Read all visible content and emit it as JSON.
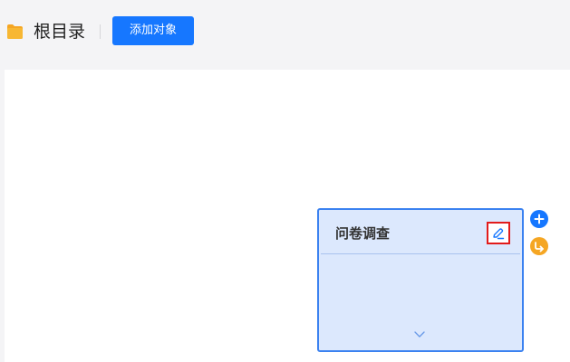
{
  "header": {
    "root_title": "根目录",
    "add_button_label": "添加对象",
    "folder_icon": "folder-icon"
  },
  "canvas": {
    "node": {
      "title": "问卷调查",
      "edit_icon": "edit-icon",
      "expand_icon": "chevron-down-icon"
    },
    "side_actions": [
      {
        "icon": "plus-circle-icon"
      },
      {
        "icon": "link-circle-icon"
      }
    ]
  },
  "colors": {
    "accent": "#1677ff",
    "node_fill": "#dce8fd",
    "node_border": "#3b82f0",
    "highlight": "#e21b1b",
    "link_action": "#f5a623"
  }
}
